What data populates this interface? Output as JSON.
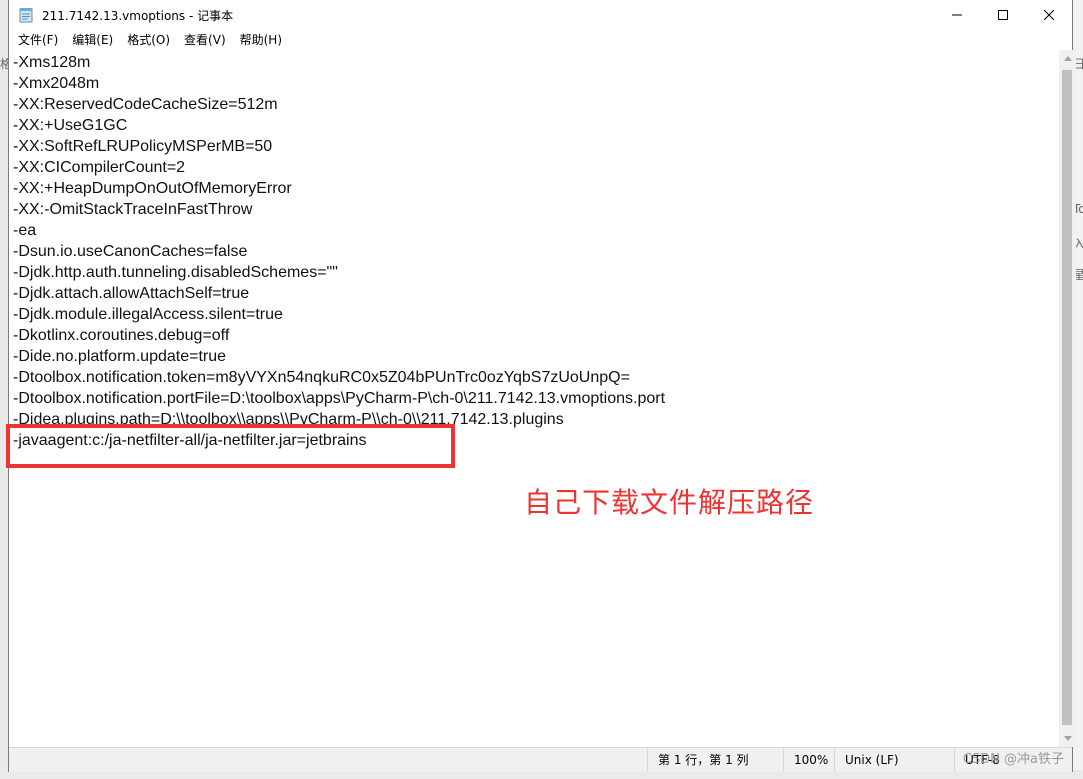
{
  "window": {
    "title": "211.7142.13.vmoptions - 记事本"
  },
  "menu": [
    {
      "label": "文件(F)",
      "name": "menu-file"
    },
    {
      "label": "编辑(E)",
      "name": "menu-edit"
    },
    {
      "label": "格式(O)",
      "name": "menu-format"
    },
    {
      "label": "查看(V)",
      "name": "menu-view"
    },
    {
      "label": "帮助(H)",
      "name": "menu-help"
    }
  ],
  "editor": {
    "lines": [
      "-Xms128m",
      "-Xmx2048m",
      "-XX:ReservedCodeCacheSize=512m",
      "-XX:+UseG1GC",
      "-XX:SoftRefLRUPolicyMSPerMB=50",
      "-XX:CICompilerCount=2",
      "-XX:+HeapDumpOnOutOfMemoryError",
      "-XX:-OmitStackTraceInFastThrow",
      "-ea",
      "-Dsun.io.useCanonCaches=false",
      "-Djdk.http.auth.tunneling.disabledSchemes=\"\"",
      "-Djdk.attach.allowAttachSelf=true",
      "-Djdk.module.illegalAccess.silent=true",
      "-Dkotlinx.coroutines.debug=off",
      "-Dide.no.platform.update=true",
      "-Dtoolbox.notification.token=m8yVYXn54nqkuRC0x5Z04bPUnTrc0ozYqbS7zUoUnpQ=",
      "-Dtoolbox.notification.portFile=D:\\toolbox\\apps\\PyCharm-P\\ch-0\\211.7142.13.vmoptions.port",
      "-Didea.plugins.path=D:\\\\toolbox\\\\apps\\\\PyCharm-P\\\\ch-0\\\\211.7142.13.plugins",
      "-javaagent:c:/ja-netfilter-all/ja-netfilter.jar=jetbrains"
    ]
  },
  "annotation": {
    "text": "自己下载文件解压路径",
    "color": "#ee3333"
  },
  "status": {
    "position": "第 1 行，第 1 列",
    "zoom": "100%",
    "line_ending": "Unix (LF)",
    "encoding": "UTF-8",
    "watermark": "CSDN @冲a铁子"
  },
  "background": {
    "left_glyph": "格",
    "right_glyphs": [
      "To",
      "入",
      "星",
      "日"
    ]
  }
}
